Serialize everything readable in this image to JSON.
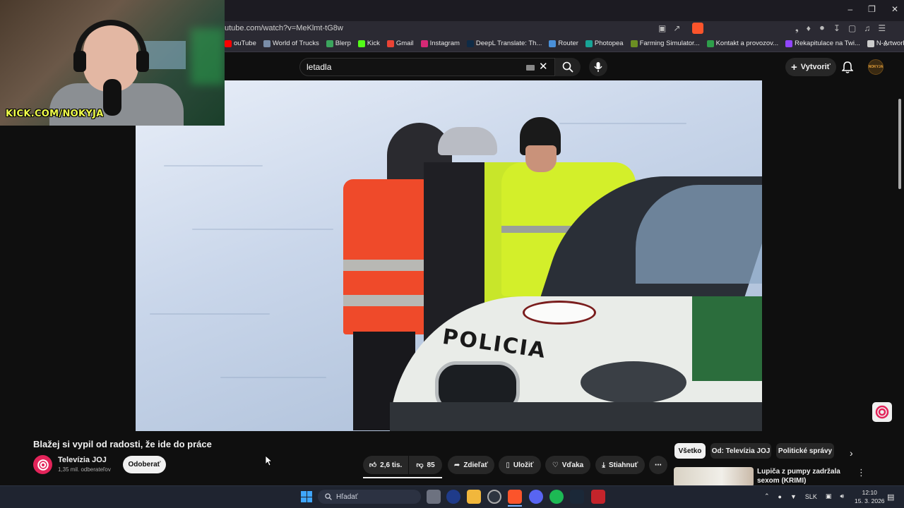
{
  "browser": {
    "url": "utube.com/watch?v=MeKlmt-tG8w",
    "bookmarks": [
      {
        "label": "ouTube",
        "color": "#ff0000"
      },
      {
        "label": "World of Trucks",
        "color": "#7a8da8"
      },
      {
        "label": "Blerp",
        "color": "#3ba55d"
      },
      {
        "label": "Kick",
        "color": "#53fc18"
      },
      {
        "label": "Gmail",
        "color": "#ea4335"
      },
      {
        "label": "Instagram",
        "color": "#d62976"
      },
      {
        "label": "DeepL Translate: Th...",
        "color": "#0f2b46"
      },
      {
        "label": "Router",
        "color": "#4a90d9"
      },
      {
        "label": "Photopea",
        "color": "#18a497"
      },
      {
        "label": "Farming Simulator...",
        "color": "#6b8e23"
      },
      {
        "label": "Kontakt a provozov...",
        "color": "#2e9e4a"
      },
      {
        "label": "Rekapitulace na Twi...",
        "color": "#9146ff"
      },
      {
        "label": "N-Artworks - PNG",
        "color": "#cccccc"
      }
    ]
  },
  "webcam": {
    "overlay_text": "KICK.COM/NOKYJA"
  },
  "youtube": {
    "search_query": "letadla",
    "create_label": "Vytvoriť",
    "avatar_text": "NOKYJA"
  },
  "video": {
    "car_lettering": "POLICIA",
    "title": "Blažej si vypil od radosti, že ide do práce",
    "channel_name": "Televízia JOJ",
    "channel_subs": "1,35 mil. odberateľov",
    "subscribe_label": "Odoberať",
    "likes": "2,6 tis.",
    "dislikes": "85",
    "share_label": "Zdieľať",
    "save_label": "Uložiť",
    "thanks_label": "Vďaka",
    "download_label": "Stiahnuť"
  },
  "sidebar": {
    "chips": [
      "Všetko",
      "Od: Televízia JOJ",
      "Politické správy"
    ],
    "recommended_title": "Lupiča z pumpy zadržala sexom (KRIMI)"
  },
  "taskbar": {
    "search_placeholder": "Hľadať",
    "language": "SLK",
    "time": "12:10",
    "date": "15. 3. 2026"
  },
  "colors": {
    "accent": "#ff0000",
    "brand_joj": "#e3245a",
    "kick_green": "#53fc18"
  }
}
